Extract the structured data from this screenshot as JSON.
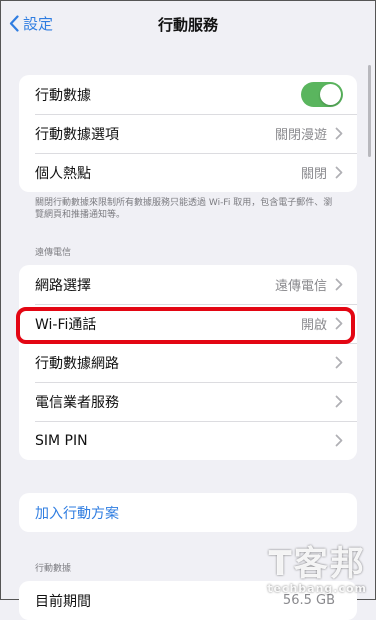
{
  "nav": {
    "back_label": "設定",
    "title": "行動服務"
  },
  "group1": {
    "cellular_data": "行動數據",
    "cellular_data_options": {
      "label": "行動數據選項",
      "value": "關閉漫遊"
    },
    "personal_hotspot": {
      "label": "個人熱點",
      "value": "關閉"
    }
  },
  "footnote": "關閉行動數據來限制所有數據服務只能透過 Wi-Fi 取用，包含電子郵件、瀏覽網頁和推播通知等。",
  "carrier_section": {
    "header": "遠傳電信",
    "network_selection": {
      "label": "網路選擇",
      "value": "遠傳電信"
    },
    "wifi_calling": {
      "label": "Wi-Fi通話",
      "value": "開啟"
    },
    "cellular_network": "行動數據網路",
    "carrier_services": "電信業者服務",
    "sim_pin": "SIM PIN"
  },
  "add_plan": "加入行動方案",
  "data_section": {
    "header": "行動數據",
    "current_period": {
      "label": "目前期間",
      "value": "56.5 GB"
    }
  },
  "watermark": {
    "big": "T客邦",
    "small": "techbang.com"
  },
  "colors": {
    "accent": "#2f7de1",
    "toggle_on": "#5ab55e",
    "highlight": "#e30613"
  }
}
